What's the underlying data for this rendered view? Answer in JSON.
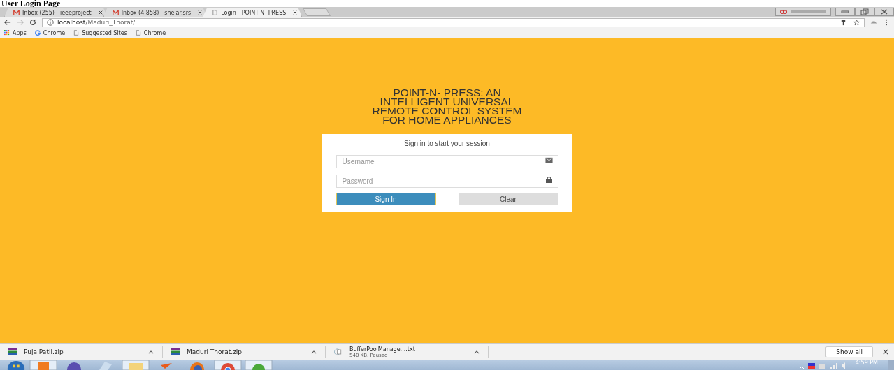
{
  "caption": "User Login Page",
  "tabs": [
    {
      "kind": "mail",
      "title": "Inbox (255) - ieeeproject",
      "selected": false
    },
    {
      "kind": "mail",
      "title": "Inbox (4,858) - shelar.srs",
      "selected": false
    },
    {
      "kind": "page",
      "title": "Login - POINT-N- PRESS",
      "selected": true
    }
  ],
  "address": {
    "host": "localhost",
    "path": "/Maduri_Thorat/"
  },
  "bookmarks": [
    {
      "kind": "apps",
      "label": "Apps"
    },
    {
      "kind": "google",
      "label": "Chrome"
    },
    {
      "kind": "page",
      "label": "Suggested Sites"
    },
    {
      "kind": "page",
      "label": "Chrome"
    }
  ],
  "heading": [
    "POINT-N- PRESS: AN",
    "INTELLIGENT UNIVERSAL",
    "REMOTE CONTROL SYSTEM",
    "FOR HOME APPLIANCES"
  ],
  "login": {
    "subtitle": "Sign in to start your session",
    "fields": [
      {
        "placeholder": "Username",
        "kind": "email"
      },
      {
        "placeholder": "Password",
        "kind": "password"
      }
    ],
    "buttons": [
      {
        "label": "Sign In",
        "kind": "primary"
      },
      {
        "label": "Clear",
        "kind": "secondary"
      }
    ]
  },
  "downloads": [
    {
      "kind": "archive",
      "name": "Puja Patil.zip"
    },
    {
      "kind": "archive",
      "name": "Maduri Thorat.zip"
    },
    {
      "kind": "text",
      "name": "BufferPoolManage....txt",
      "status": "540 KB, Paused"
    }
  ],
  "show_all": "Show all",
  "clock": "4:59 PM"
}
